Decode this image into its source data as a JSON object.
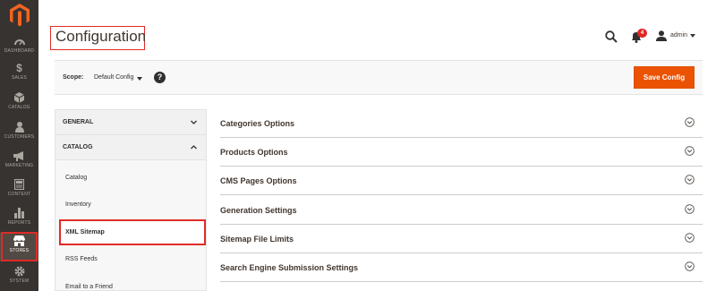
{
  "nav": {
    "items": [
      {
        "label": "DASHBOARD",
        "icon": "dashboard-icon"
      },
      {
        "label": "SALES",
        "icon": "dollar-icon"
      },
      {
        "label": "CATALOG",
        "icon": "cube-icon"
      },
      {
        "label": "CUSTOMERS",
        "icon": "customers-icon"
      },
      {
        "label": "MARKETING",
        "icon": "megaphone-icon"
      },
      {
        "label": "CONTENT",
        "icon": "content-icon"
      },
      {
        "label": "REPORTS",
        "icon": "bar-chart-icon"
      },
      {
        "label": "STORES",
        "icon": "store-icon"
      },
      {
        "label": "SYSTEM",
        "icon": "gear-icon"
      }
    ],
    "active": "STORES"
  },
  "header": {
    "title": "Configuration",
    "notifications_count": "4",
    "user": "admin"
  },
  "scope": {
    "label": "Scope:",
    "value": "Default Config",
    "help": "?",
    "save_label": "Save Config"
  },
  "tabs": {
    "groups": [
      {
        "label": "GENERAL"
      },
      {
        "label": "CATALOG"
      }
    ],
    "items": [
      "Catalog",
      "Inventory",
      "XML Sitemap",
      "RSS Feeds",
      "Email to a Friend"
    ]
  },
  "sections": [
    "Categories Options",
    "Products Options",
    "CMS Pages Options",
    "Generation Settings",
    "Sitemap File Limits",
    "Search Engine Submission Settings"
  ],
  "colors": {
    "nav_bg": "#373330",
    "accent": "#eb5202",
    "highlight": "#e02b27"
  }
}
